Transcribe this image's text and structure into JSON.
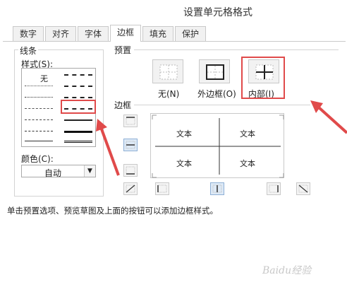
{
  "window": {
    "title": "设置单元格格式"
  },
  "tabs": [
    {
      "label": "数字",
      "active": false
    },
    {
      "label": "对齐",
      "active": false
    },
    {
      "label": "字体",
      "active": false
    },
    {
      "label": "边框",
      "active": true
    },
    {
      "label": "填充",
      "active": false
    },
    {
      "label": "保护",
      "active": false
    }
  ],
  "line": {
    "group_label": "线条",
    "style_label": "样式(S):",
    "none_label": "无",
    "color_label": "颜色(C):",
    "color_value": "自动"
  },
  "presets": {
    "group_label": "预置",
    "items": [
      {
        "label": "无(N)"
      },
      {
        "label": "外边框(O)"
      },
      {
        "label": "内部(I)"
      }
    ]
  },
  "border": {
    "group_label": "边框",
    "cell_text": "文本"
  },
  "hint": "单击预置选项、预览草图及上面的按钮可以添加边框样式。",
  "watermark": "Baidu经验",
  "colors": {
    "highlight": "#e04a4a",
    "selected_bg": "#dde9f6"
  }
}
